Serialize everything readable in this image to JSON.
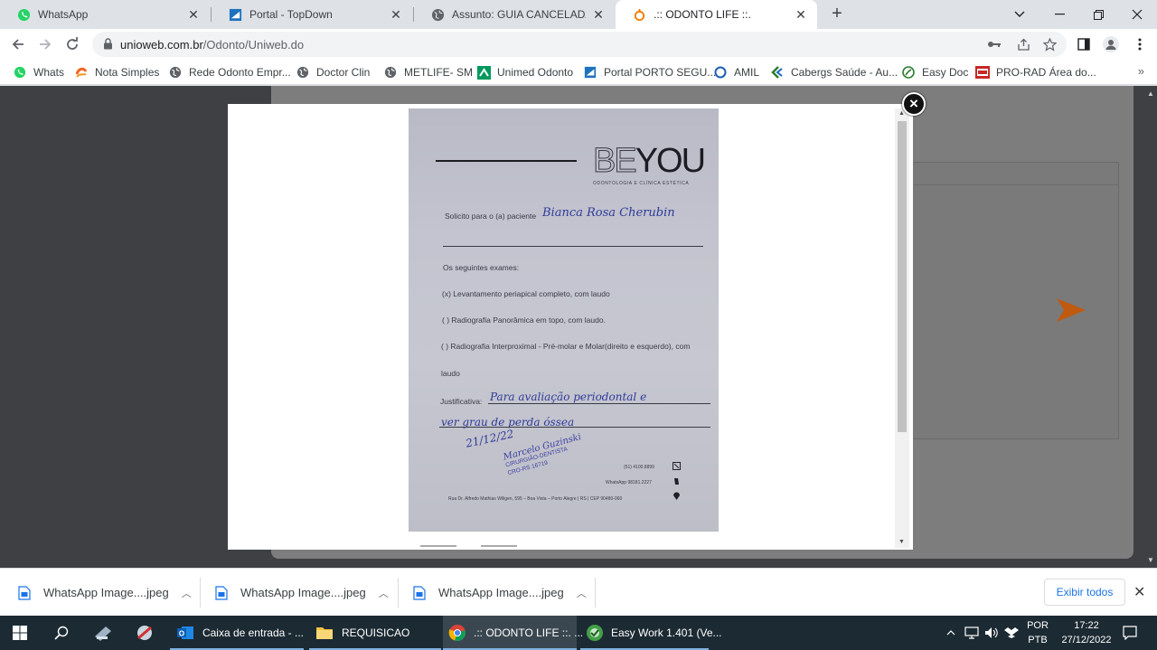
{
  "tabs": [
    {
      "label": "WhatsApp",
      "icon": "whatsapp-icon"
    },
    {
      "label": "Portal - TopDown",
      "icon": "portal-icon"
    },
    {
      "label": "Assunto: GUIA CANCELADA - GTO",
      "icon": "globe-icon"
    },
    {
      "label": ".:: ODONTO LIFE ::.",
      "icon": "odonto-icon",
      "active": true
    }
  ],
  "address": {
    "domain": "unioweb.com.br",
    "path": "/Odonto/Uniweb.do"
  },
  "bookmarks": [
    {
      "label": "Whats",
      "icon": "whatsapp-icon"
    },
    {
      "label": "Nota Simples",
      "icon": "nota-icon"
    },
    {
      "label": "Rede Odonto Empr...",
      "icon": "globe-icon"
    },
    {
      "label": "Doctor Clin",
      "icon": "globe-icon"
    },
    {
      "label": "METLIFE- SM",
      "icon": "globe-icon"
    },
    {
      "label": "Unimed Odonto",
      "icon": "unimed-icon"
    },
    {
      "label": "Portal PORTO SEGU...",
      "icon": "portal-icon"
    },
    {
      "label": "AMIL",
      "icon": "amil-icon"
    },
    {
      "label": "Cabergs Saúde - Au...",
      "icon": "cabergs-icon"
    },
    {
      "label": "Easy Doc",
      "icon": "easydoc-icon"
    },
    {
      "label": "PRO-RAD Área do...",
      "icon": "prorad-icon"
    }
  ],
  "document": {
    "logo_be": "BE",
    "logo_you": "YOU",
    "logo_sub": "ODONTOLOGIA E CLÍNICA ESTÉTICA",
    "patient_label": "Solicito para o (a) paciente",
    "patient_name": "Bianca Rosa Cherubin",
    "exams_label": "Os seguintes exames:",
    "exam_1": "(x) Levantamento periapical completo, com laudo",
    "exam_2": "(  ) Radiografia Panorâmica em topo, com laudo.",
    "exam_3": "(  ) Radiografia Interproximal - Pré-molar e Molar(direito e esquerdo), com",
    "exam_3b": "laudo",
    "justification_label": "Justificativa:",
    "justification_1": "Para avaliação periodontal e",
    "justification_2": "ver grau de perda óssea",
    "date": "21/12/22",
    "stamp_name": "Marcelo Guzinski",
    "stamp_role": "CIRURGIÃO-DENTISTA",
    "stamp_cro": "CRO-RS 16719",
    "phone": "(51) 4100.8899",
    "whatsapp": "WhatsApp 98181.2227",
    "address": "Rua Dr. Alfredo Mathias Wiligen, 595 – Boa Vista – Porto Alegre | RS | CEP 90480-060"
  },
  "downloads": [
    {
      "label": "WhatsApp Image....jpeg"
    },
    {
      "label": "WhatsApp Image....jpeg"
    },
    {
      "label": "WhatsApp Image....jpeg"
    }
  ],
  "show_all_label": "Exibir todos",
  "taskbar": {
    "apps": [
      {
        "label": "Caixa de entrada - ...",
        "icon": "outlook-icon"
      },
      {
        "label": "REQUISICAO",
        "icon": "folder-icon"
      },
      {
        "label": ".:: ODONTO LIFE ::. ...",
        "icon": "chrome-icon",
        "active": true
      },
      {
        "label": "Easy Work 1.401 (Ve...",
        "icon": "easywork-icon"
      }
    ],
    "lang_1": "POR",
    "lang_2": "PTB",
    "time": "17:22",
    "date": "27/12/2022"
  },
  "colors": {
    "accent_link": "#1a73e8",
    "taskbar": "#1c2a33",
    "handwriting": "#2f3a9a",
    "arrow": "#c05a10"
  }
}
